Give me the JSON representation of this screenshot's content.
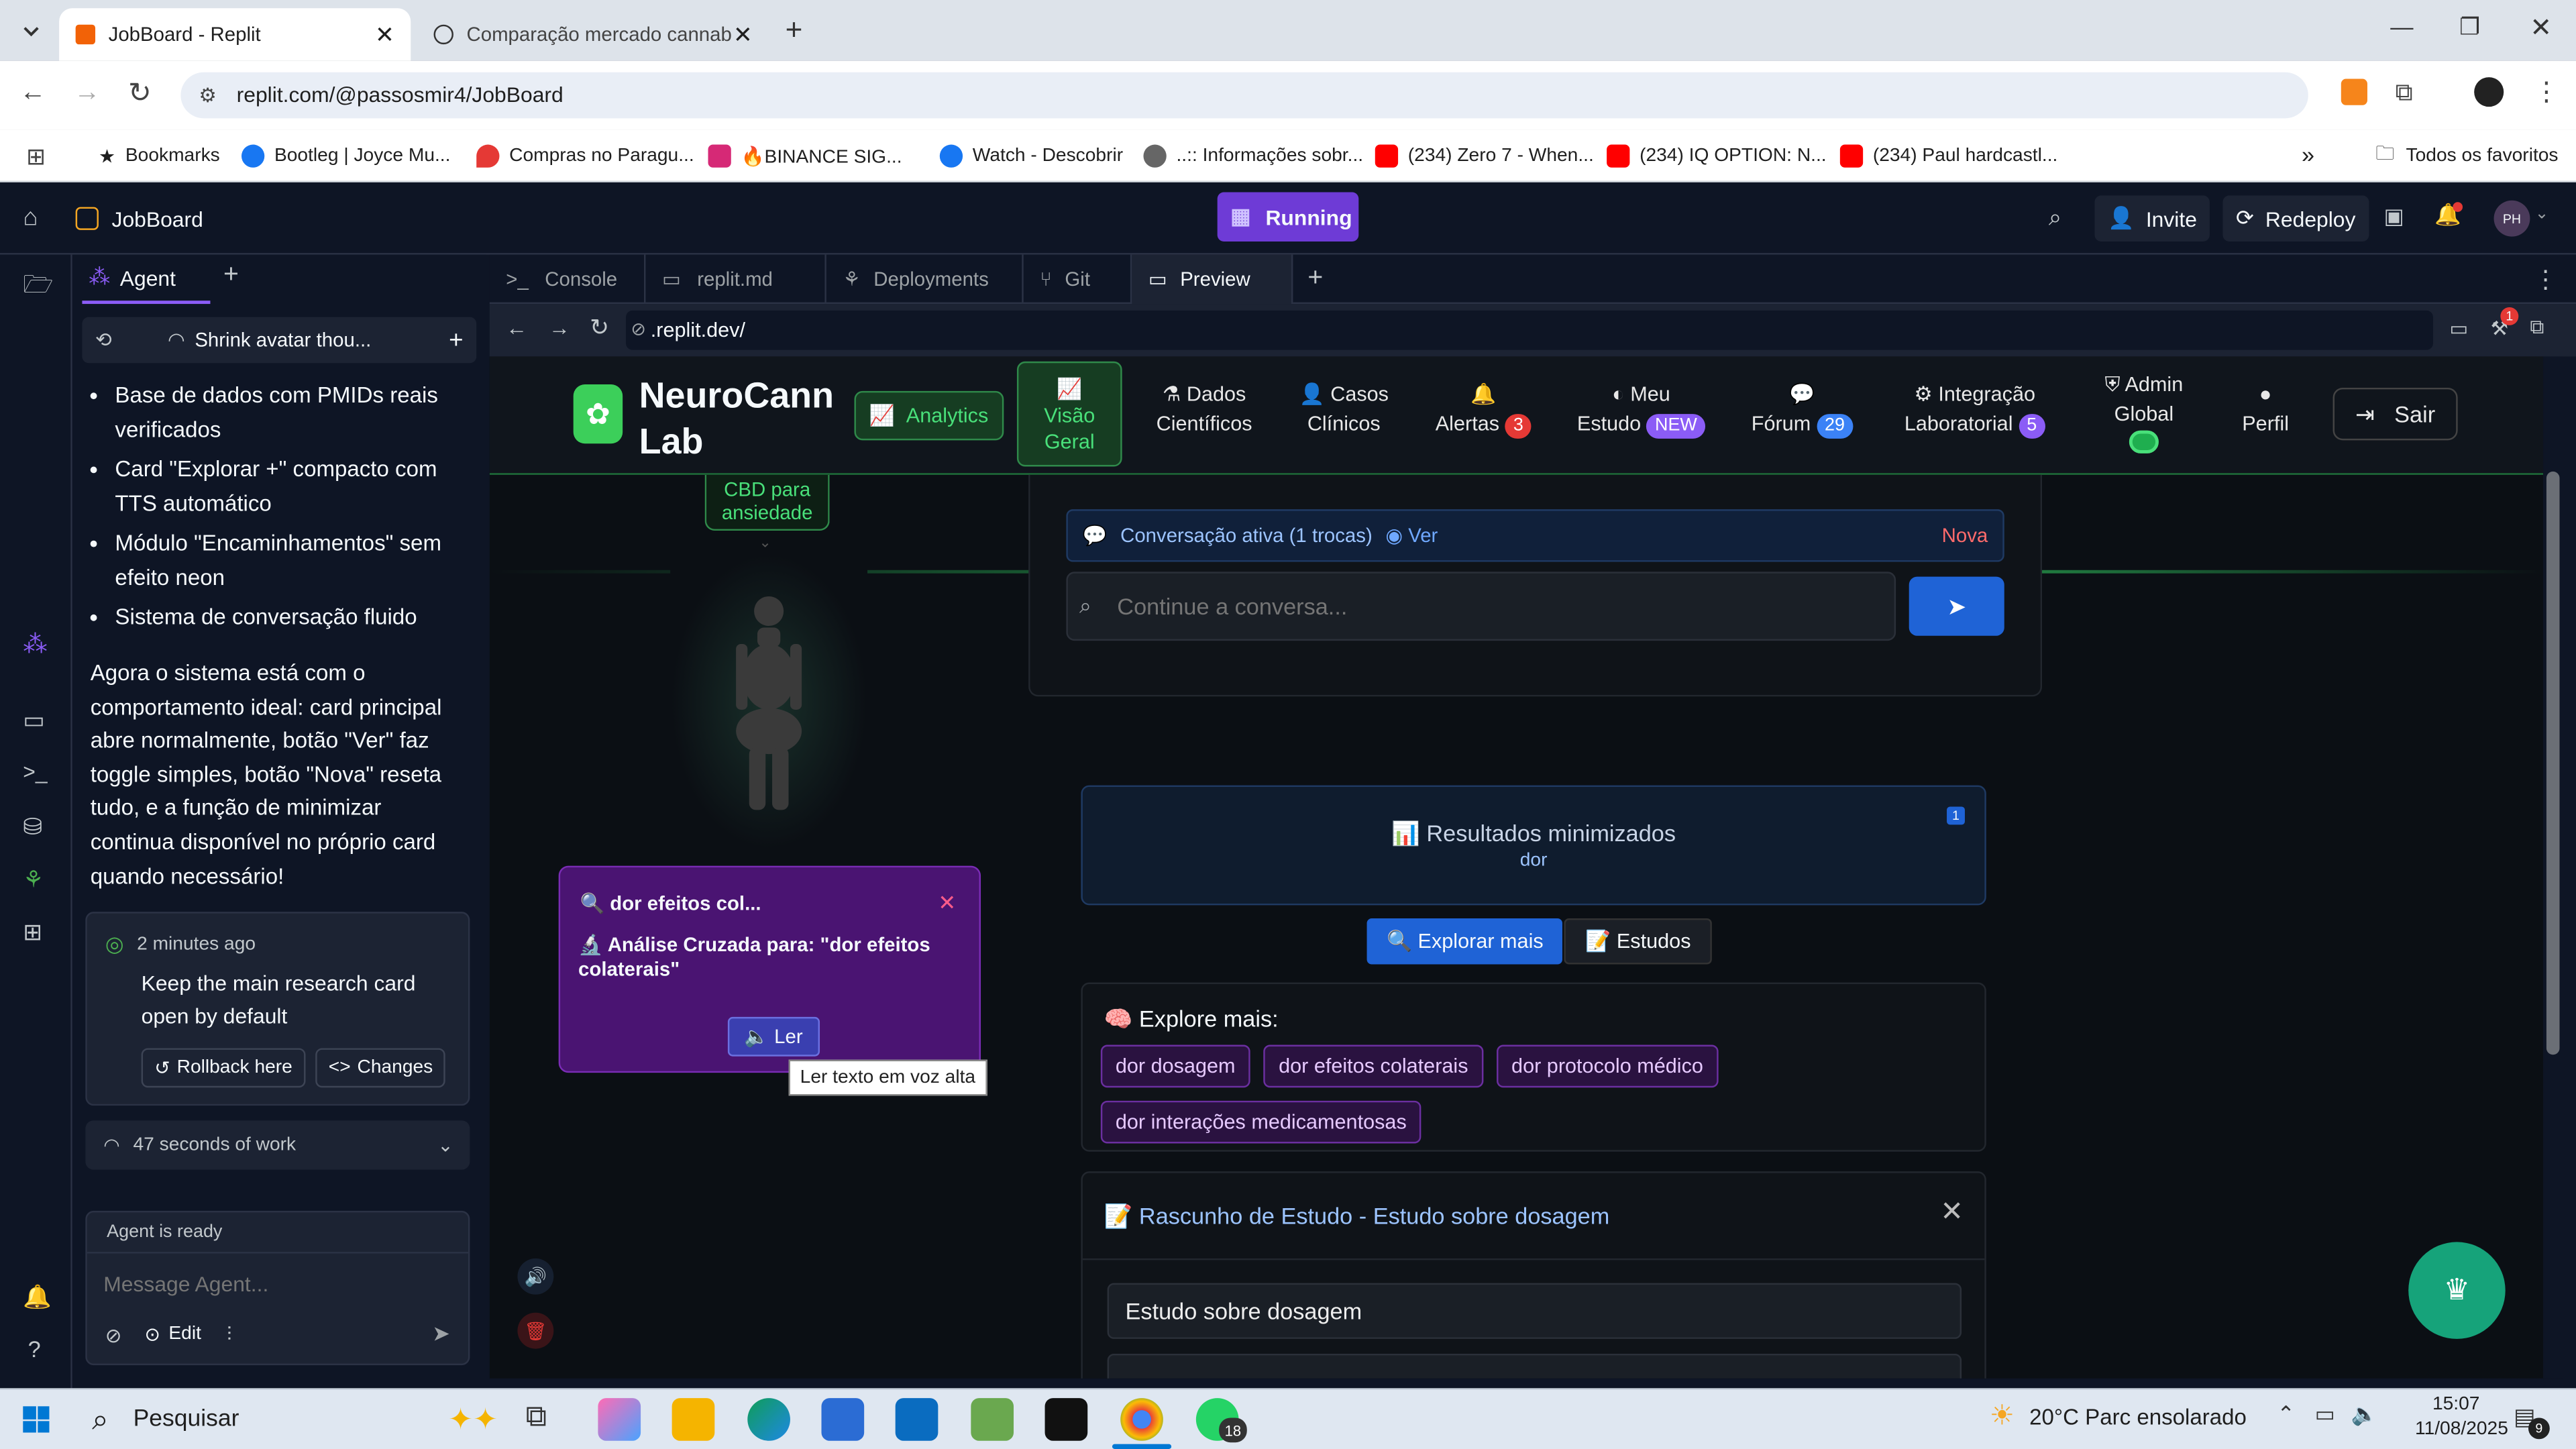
{
  "browser": {
    "tabs": [
      {
        "title": "JobBoard - Replit"
      },
      {
        "title": "Comparação mercado cannabis"
      }
    ],
    "url": "replit.com/@passosmir4/JobBoard",
    "bookmarks": [
      {
        "label": "Bookmarks",
        "color": "#555"
      },
      {
        "label": "Bootleg | Joyce Mu...",
        "color": "#1877f2"
      },
      {
        "label": "Compras no Paragu...",
        "color": "#e53935"
      },
      {
        "label": "🔥BINANCE SIG...",
        "color": "#d62976"
      },
      {
        "label": "Watch - Descobrir",
        "color": "#1877f2"
      },
      {
        "label": "..:: Informações sobr...",
        "color": "#555"
      },
      {
        "label": "(234) Zero 7 - When...",
        "color": "#ff0000"
      },
      {
        "label": "(234) IQ OPTION: N...",
        "color": "#ff0000"
      },
      {
        "label": "(234) Paul hardcastl...",
        "color": "#ff0000"
      }
    ],
    "all_bookmarks": "Todos os favoritos"
  },
  "replit": {
    "project": "JobBoard",
    "run_label": "Running",
    "invite": "Invite",
    "redeploy": "Redeploy",
    "avatar": "PH",
    "agent_tab": "Agent",
    "thread_title": "Shrink avatar thou...",
    "bullets": [
      "Base de dados com PMIDs reais verificados",
      "Card \"Explorar +\" compacto com TTS automático",
      "Módulo \"Encaminhamentos\" sem efeito neon",
      "Sistema de conversação fluido"
    ],
    "summary": "Agora o sistema está com o comportamento ideal: card principal abre normalmente, botão \"Ver\" faz toggle simples, botão \"Nova\" reseta tudo, e a função de minimizar continua disponível no próprio card quando necessário!",
    "checkpoint": {
      "time": "2 minutes ago",
      "message": "Keep the main research card open by default",
      "rollback": "Rollback here",
      "changes": "Changes"
    },
    "work": "47 seconds of work",
    "status": "Agent is ready",
    "input_placeholder": "Message Agent...",
    "edit": "Edit",
    "pane_tabs": [
      "Console",
      "replit.md",
      "Deployments",
      "Git",
      "Preview"
    ],
    "preview_url": ".replit.dev/",
    "notif_count": "1"
  },
  "app": {
    "brand": "NeuroCann Lab",
    "analytics": "Analytics",
    "visao": "Visão Geral",
    "nav": [
      {
        "l1": "Dados",
        "l2": "Científicos"
      },
      {
        "l1": "Casos",
        "l2": "Clínicos"
      },
      {
        "l1": "",
        "l2": "Alertas",
        "badge": "3",
        "badge_color": "#e53935"
      },
      {
        "l1": "Meu",
        "l2": "Estudo",
        "badge": "NEW",
        "badge_color": "#8b5cf6"
      },
      {
        "l1": "",
        "l2": "Fórum",
        "badge": "29",
        "badge_color": "#3b82f6"
      },
      {
        "l1": "Integração",
        "l2": "Laboratorial",
        "badge": "5",
        "badge_color": "#8b5cf6"
      },
      {
        "l1": "Admin",
        "l2": "Global"
      },
      {
        "l1": "",
        "l2": "Perfil"
      }
    ],
    "logout": "Sair",
    "avatar_label": "CBD para ansiedade",
    "conv_status": "Conversação ativa (1 trocas)",
    "ver": "Ver",
    "nova": "Nova",
    "continue_placeholder": "Continue a conversa...",
    "popup": {
      "title": "🔍 dor efeitos col...",
      "body": "🔬 Análise Cruzada para: \"dor efeitos colaterais\"",
      "read": "🔈 Ler",
      "tooltip": "Ler texto em voz alta"
    },
    "minimized": {
      "title": "📊 Resultados minimizados",
      "sub": "dor",
      "count": "1"
    },
    "explore_btn": "🔍 Explorar mais",
    "estudos_btn": "📝 Estudos",
    "explore_title": "🧠 Explore mais:",
    "chips": [
      "dor dosagem",
      "dor efeitos colaterais",
      "dor protocolo médico",
      "dor interações medicamentosas"
    ],
    "draft_title": "📝 Rascunho de Estudo - Estudo sobre dosagem",
    "draft_input": "Estudo sobre dosagem"
  },
  "taskbar": {
    "search": "Pesquisar",
    "weather": "20°C  Parc ensolarado",
    "time": "15:07",
    "date": "11/08/2025",
    "whatsapp_badge": "18",
    "notif_badge": "9"
  }
}
